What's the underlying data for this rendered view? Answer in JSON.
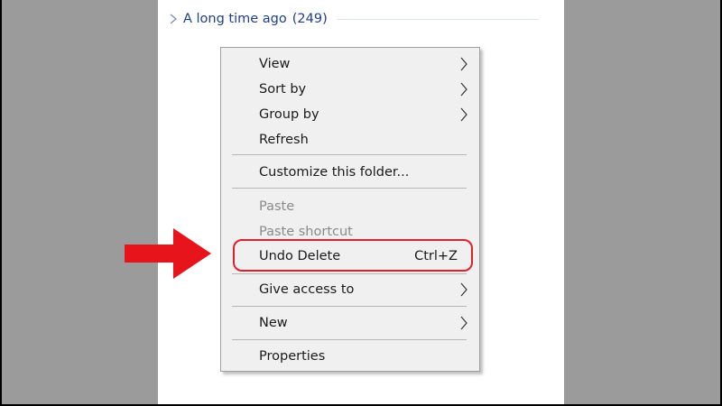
{
  "explorer": {
    "group_label": "A long time ago",
    "group_count": "(249)"
  },
  "context_menu": {
    "items": [
      {
        "label": "View",
        "has_submenu": true,
        "enabled": true
      },
      {
        "label": "Sort by",
        "has_submenu": true,
        "enabled": true
      },
      {
        "label": "Group by",
        "has_submenu": true,
        "enabled": true
      },
      {
        "label": "Refresh",
        "has_submenu": false,
        "enabled": true
      },
      {
        "label": "Customize this folder...",
        "has_submenu": false,
        "enabled": true
      },
      {
        "label": "Paste",
        "has_submenu": false,
        "enabled": false
      },
      {
        "label": "Paste shortcut",
        "has_submenu": false,
        "enabled": false
      },
      {
        "label": "Undo Delete",
        "shortcut": "Ctrl+Z",
        "has_submenu": false,
        "enabled": true,
        "highlighted": true
      },
      {
        "label": "Give access to",
        "has_submenu": true,
        "enabled": true
      },
      {
        "label": "New",
        "has_submenu": true,
        "enabled": true
      },
      {
        "label": "Properties",
        "has_submenu": false,
        "enabled": true
      }
    ]
  },
  "colors": {
    "annotation": "#e0202a",
    "group_text": "#1e3f8c",
    "disabled_text": "#8a8a8a"
  },
  "icons": [
    "chevron-right-icon",
    "red-arrow-icon"
  ]
}
